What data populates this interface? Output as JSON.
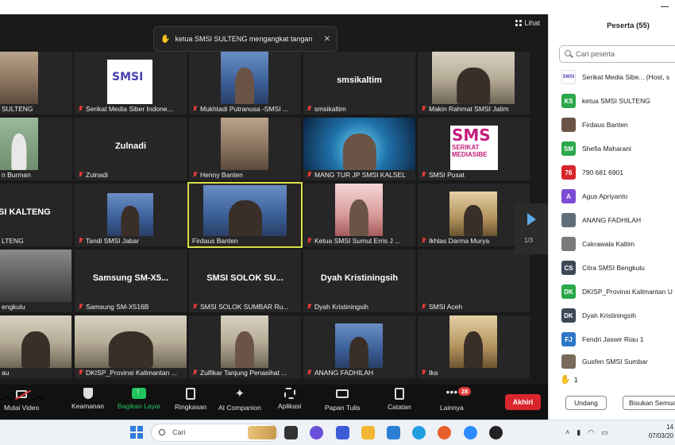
{
  "meeting": {
    "view_label": "Lihat",
    "notification": "ketua SMSI SULTENG mengangkat tangan",
    "page_indicator": "1/3",
    "tiles": [
      {
        "label": "SULTENG",
        "big": ""
      },
      {
        "label": "Serikat Media Siber Indone...",
        "big": ""
      },
      {
        "label": "Mukhtadi Putranusa -SMSI ...",
        "big": ""
      },
      {
        "label": "smsikaltim",
        "big": "smsikaltim"
      },
      {
        "label": "Makin Rahmat SMSI Jatim",
        "big": ""
      },
      {
        "label": "n Burman",
        "big": ""
      },
      {
        "label": "Zulnadi",
        "big": "Zulnadi"
      },
      {
        "label": "Henny Banten",
        "big": ""
      },
      {
        "label": "MANG TUR JP SMSI KALSEL",
        "big": ""
      },
      {
        "label": "SMSI Pusat",
        "big": ""
      },
      {
        "label": "LTENG",
        "big": "SI KALTENG"
      },
      {
        "label": "Tandi SMSI Jabar",
        "big": ""
      },
      {
        "label": "Firdaus Banten",
        "big": ""
      },
      {
        "label": "Ketua SMSI Sumut Erris J ...",
        "big": ""
      },
      {
        "label": "Ikhlas Darma Murya",
        "big": ""
      },
      {
        "label": "engkulu",
        "big": ""
      },
      {
        "label": "Samsung SM-X516B",
        "big": "Samsung SM-X5..."
      },
      {
        "label": "SMSI SOLOK SUMBAR Ru...",
        "big": "SMSI SOLOK SU..."
      },
      {
        "label": "Dyah Kristiningsih",
        "big": "Dyah Kristiningsih"
      },
      {
        "label": "SMSI Aceh",
        "big": ""
      },
      {
        "label": "au",
        "big": ""
      },
      {
        "label": "DKISP_Provinsi Kalimantan ...",
        "big": ""
      },
      {
        "label": "Zulfikar Tanjung Penasihat ...",
        "big": ""
      },
      {
        "label": "ANANG FADHILAH",
        "big": ""
      },
      {
        "label": "Ika",
        "big": ""
      }
    ],
    "logo_text": "SMSI",
    "logo_big_line1": "SMS",
    "logo_big_line2": "SERIKAT MEDIASIBE"
  },
  "toolbar": {
    "stop_video": "Mulai Video",
    "security": "Keamanan",
    "share": "Bagikan Layar",
    "summary": "Ringkasan",
    "ai": "AI Companion",
    "apps": "Aplikasi",
    "whiteboard": "Papan Tulis",
    "notes": "Catatan",
    "more": "Lainnya",
    "more_badge": "28",
    "end": "Akhiri"
  },
  "panel": {
    "title": "Peserta (55)",
    "search_placeholder": "Cari peserta",
    "participants": [
      {
        "name": "Serikat Media Sibe... (Host, s",
        "initials": "",
        "color": "#ffffff"
      },
      {
        "name": "ketua SMSI SULTENG",
        "initials": "KS",
        "color": "#2aa84a"
      },
      {
        "name": "Firdaus Banten",
        "initials": "",
        "color": "#6b5446"
      },
      {
        "name": "Shefia Maharani",
        "initials": "SM",
        "color": "#2aa84a"
      },
      {
        "name": "790 681 6901",
        "initials": "76",
        "color": "#d9252c"
      },
      {
        "name": "Agus Apriyanto",
        "initials": "A",
        "color": "#7b4bd6"
      },
      {
        "name": "ANANG FADHILAH",
        "initials": "",
        "color": "#5f6f7a"
      },
      {
        "name": "Cakrawala Kaltim",
        "initials": "",
        "color": "#7a7a7a"
      },
      {
        "name": "Citra SMSI Bengkulu",
        "initials": "CS",
        "color": "#3c4757"
      },
      {
        "name": "DKISP_Provinsi Kalimantan U",
        "initials": "DK",
        "color": "#2aa84a"
      },
      {
        "name": "Dyah Kristiningsih",
        "initials": "DK",
        "color": "#3c4757"
      },
      {
        "name": "Fendri Jaswir Riau 1",
        "initials": "FJ",
        "color": "#2e78c7"
      },
      {
        "name": "Gusfen SMSI Sumbar",
        "initials": "",
        "color": "#7a6a5a"
      }
    ],
    "raised_count": "1",
    "invite": "Undang",
    "mute_all": "Bisukan Semua"
  },
  "taskbar": {
    "search_placeholder": "Cari",
    "clock_time": "14",
    "clock_date": "07/03/20"
  }
}
